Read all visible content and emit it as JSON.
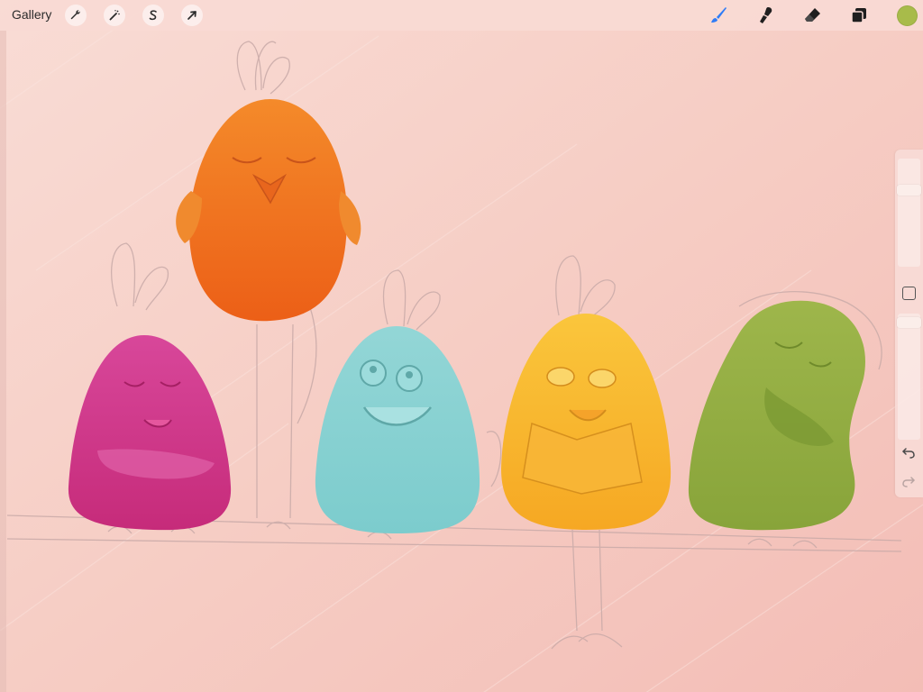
{
  "toolbar": {
    "gallery_label": "Gallery",
    "left_tools": [
      {
        "name": "actions",
        "icon": "wrench-icon"
      },
      {
        "name": "adjustments",
        "icon": "magic-wand-icon"
      },
      {
        "name": "selection",
        "icon": "selection-s-icon"
      },
      {
        "name": "transform",
        "icon": "arrow-cursor-icon"
      }
    ],
    "right_tools": [
      {
        "name": "brush",
        "icon": "brush-icon",
        "active": true
      },
      {
        "name": "smudge",
        "icon": "smudge-icon"
      },
      {
        "name": "eraser",
        "icon": "eraser-icon"
      },
      {
        "name": "layers",
        "icon": "layers-icon"
      }
    ],
    "current_color": "#a8bb4a"
  },
  "sidebar": {
    "brush_size_level": 0.27,
    "brush_opacity_level": 0.03,
    "icons": [
      "undo-icon",
      "redo-icon"
    ]
  },
  "canvas": {
    "background_color": "#f7cfc7",
    "characters": [
      {
        "name": "orange-bird",
        "color": "#f07a1f"
      },
      {
        "name": "magenta-bird",
        "color": "#d23c8a"
      },
      {
        "name": "cyan-bird",
        "color": "#86d2d2"
      },
      {
        "name": "yellow-bird",
        "color": "#f8b52f"
      },
      {
        "name": "green-bird",
        "color": "#93ad42"
      }
    ]
  },
  "colors": {
    "accent_blue": "#2f7cf6",
    "icon_dark": "#1f1f1f"
  }
}
